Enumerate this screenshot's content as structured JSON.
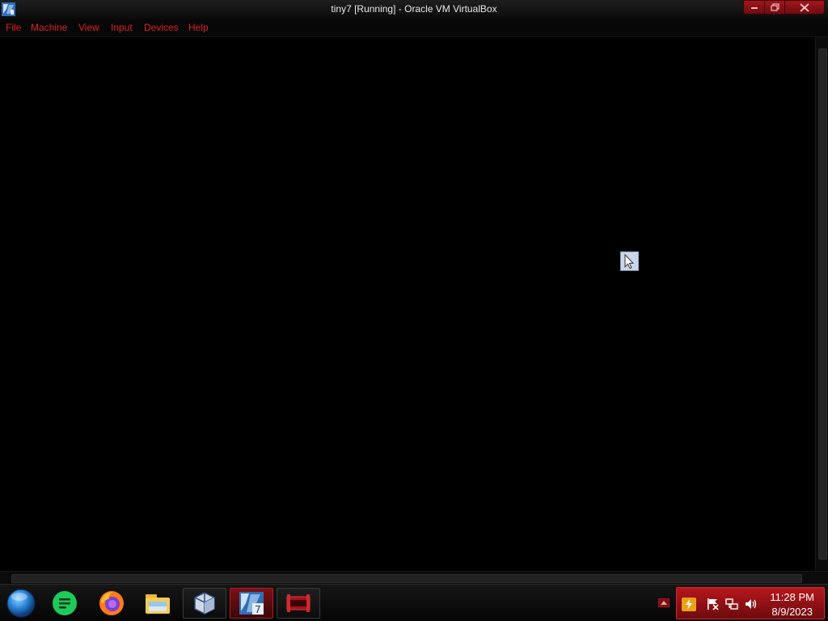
{
  "window": {
    "title": "tiny7 [Running] - Oracle VM VirtualBox"
  },
  "menu": {
    "items": [
      {
        "label": "File"
      },
      {
        "label": "Machine"
      },
      {
        "label": "View"
      },
      {
        "label": "Input"
      },
      {
        "label": "Devices"
      },
      {
        "label": "Help"
      }
    ]
  },
  "taskbar": {
    "apps": [
      {
        "name": "start-orb"
      },
      {
        "name": "notes-app-icon"
      },
      {
        "name": "firefox-icon"
      },
      {
        "name": "file-explorer-icon"
      },
      {
        "name": "virtualbox-manager-icon"
      },
      {
        "name": "virtualbox-vm-icon"
      },
      {
        "name": "red-app-icon"
      }
    ]
  },
  "tray": {
    "time": "11:28 PM",
    "date": "8/9/2023"
  },
  "colors": {
    "accent": "#e0201f",
    "tray_bg": "#b5171c",
    "background": "#000000"
  }
}
